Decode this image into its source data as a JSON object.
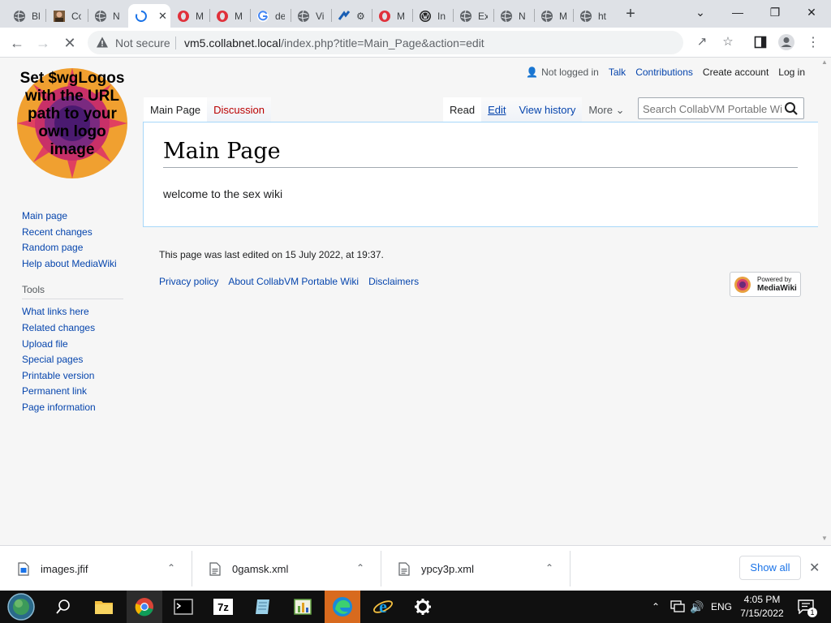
{
  "browser": {
    "tabs": [
      {
        "label": "Bl",
        "icon": "globe-icon"
      },
      {
        "label": "Co",
        "icon": "avatar-icon"
      },
      {
        "label": "N",
        "icon": "globe-icon"
      },
      {
        "label": "",
        "icon": "loading-spinner-icon",
        "active": true
      },
      {
        "label": "M",
        "icon": "opera-icon"
      },
      {
        "label": "M",
        "icon": "opera-icon"
      },
      {
        "label": "de",
        "icon": "google-icon"
      },
      {
        "label": "Vi",
        "icon": "globe-icon"
      },
      {
        "label": "",
        "icon": "puzzle-icon"
      },
      {
        "label": "M",
        "icon": "opera-icon"
      },
      {
        "label": "In",
        "icon": "wordpress-icon"
      },
      {
        "label": "Ex",
        "icon": "globe-icon"
      },
      {
        "label": "N",
        "icon": "globe-icon"
      },
      {
        "label": "M",
        "icon": "globe-icon"
      },
      {
        "label": "ht",
        "icon": "globe-icon"
      }
    ],
    "new_tab": "+",
    "close_tab": "✕",
    "window_controls": {
      "dropdown": "⌄",
      "minimize": "—",
      "restore": "❐",
      "close": "✕"
    },
    "security_label": "Not secure",
    "url_host": "vm5.collabnet.local",
    "url_path": "/index.php?title=Main_Page&action=edit"
  },
  "wiki": {
    "logo_text": "Set $wgLogos with the URL path to your own logo image",
    "personal": {
      "not_logged_in": "Not logged in",
      "talk": "Talk",
      "contributions": "Contributions",
      "create_account": "Create account",
      "log_in": "Log in"
    },
    "tabs_left": [
      "Main Page",
      "Discussion"
    ],
    "tabs_right": {
      "read": "Read",
      "edit": "Edit",
      "view_history": "View history",
      "more": "More"
    },
    "search_placeholder": "Search CollabVM Portable Wiki",
    "title": "Main Page",
    "body": "welcome to the sex wiki",
    "nav": [
      "Main page",
      "Recent changes",
      "Random page",
      "Help about MediaWiki"
    ],
    "tools_heading": "Tools",
    "tools": [
      "What links here",
      "Related changes",
      "Upload file",
      "Special pages",
      "Printable version",
      "Permanent link",
      "Page information"
    ],
    "last_edited": "This page was last edited on 15 July 2022, at 19:37.",
    "footer_links": [
      "Privacy policy",
      "About CollabVM Portable Wiki",
      "Disclaimers"
    ],
    "powered_by": {
      "line1": "Powered by",
      "line2": "MediaWiki"
    }
  },
  "downloads": {
    "items": [
      "images.jfif",
      "0gamsk.xml",
      "ypcy3p.xml"
    ],
    "show_all": "Show all",
    "close": "✕"
  },
  "taskbar": {
    "language": "ENG",
    "time": "4:05 PM",
    "date": "7/15/2022",
    "notification_count": "1"
  },
  "colors": {
    "link": "#0645ad",
    "redlink": "#ba0000",
    "chrome_accent": "#1a73e8"
  }
}
